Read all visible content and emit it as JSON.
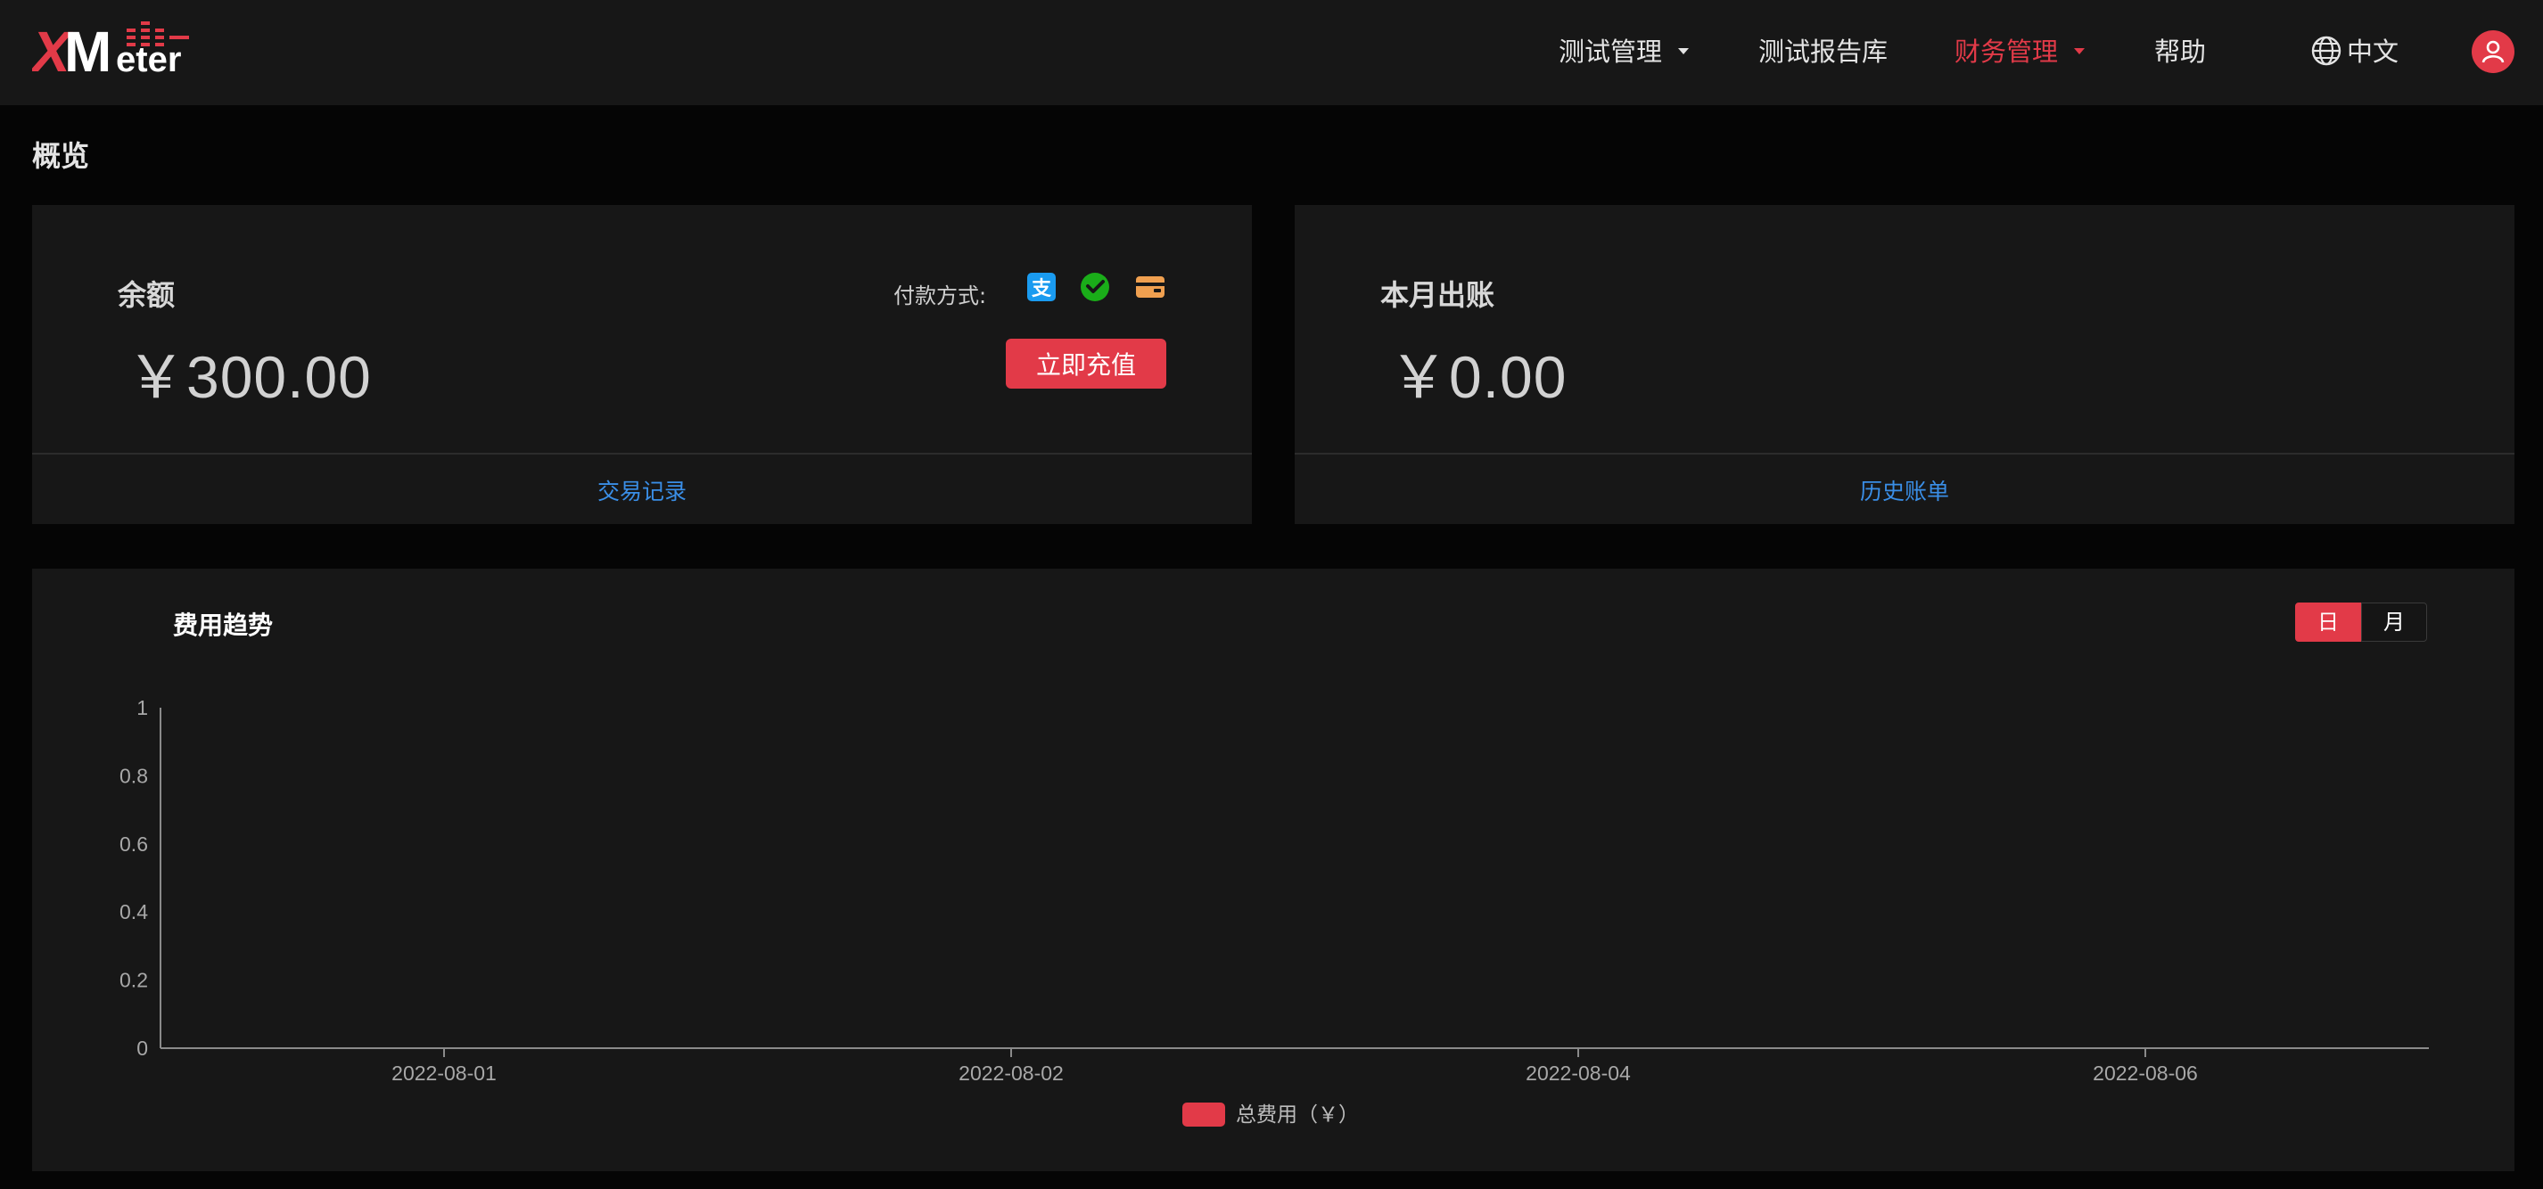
{
  "header": {
    "logo_text": "XMeter",
    "nav": [
      {
        "label": "测试管理",
        "dropdown": true,
        "active": false
      },
      {
        "label": "测试报告库",
        "dropdown": false,
        "active": false
      },
      {
        "label": "财务管理",
        "dropdown": true,
        "active": true
      },
      {
        "label": "帮助",
        "dropdown": false,
        "active": false
      }
    ],
    "language": "中文",
    "language_icon": "globe-icon",
    "avatar_icon": "user-icon"
  },
  "page": {
    "title": "概览"
  },
  "balance_card": {
    "label": "余额",
    "amount": "￥300.00",
    "payment_label": "付款方式:",
    "payment_icons": [
      "alipay-icon",
      "wechat-pay-icon",
      "card-icon"
    ],
    "recharge_button": "立即充值",
    "link": "交易记录"
  },
  "monthly_card": {
    "label": "本月出账",
    "amount": "￥0.00",
    "link": "历史账单"
  },
  "trend_card": {
    "title": "费用趋势",
    "toggle": {
      "day": "日",
      "month": "月",
      "selected": "日"
    }
  },
  "chart_data": {
    "type": "bar",
    "title": "费用趋势",
    "xlabel": "",
    "ylabel": "",
    "x_tick_labels": [
      "2022-08-01",
      "2022-08-02",
      "2022-08-04",
      "2022-08-06"
    ],
    "y_ticks": [
      "0",
      "0.2",
      "0.4",
      "0.6",
      "0.8",
      "1"
    ],
    "ylim": [
      0,
      1
    ],
    "series": [
      {
        "name": "总费用（￥）",
        "values": [],
        "color": "#e23a48"
      }
    ],
    "legend": "bottom-center",
    "grid": false
  },
  "colors": {
    "accent": "#e23a48",
    "link": "#3a8ee6",
    "card_bg": "#171717",
    "page_bg": "#050505",
    "alipay": "#1a9bf0",
    "wechat": "#1aad19",
    "card_pay": "#f0a050"
  }
}
